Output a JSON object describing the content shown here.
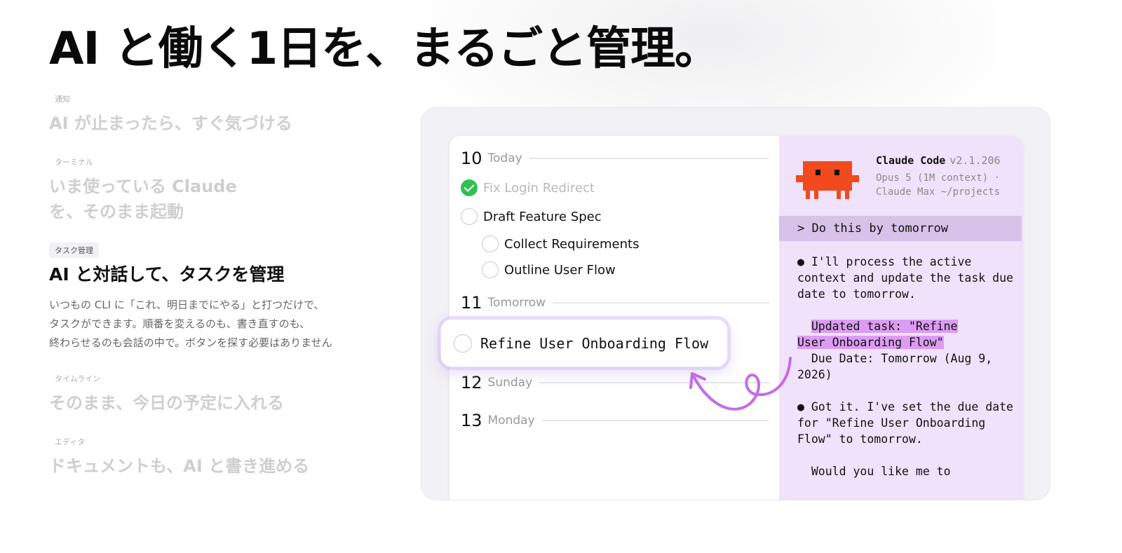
{
  "headline": "AI と働く1日を、まるごと管理。",
  "features": [
    {
      "tag": "通知",
      "title": "AI が止まったら、すぐ気づける"
    },
    {
      "tag": "ターミナル",
      "title": "いま使っている Claude\nを、そのまま起動"
    },
    {
      "tag": "タスク管理",
      "title": "AI と対話して、タスクを管理",
      "desc": "いつもの CLI に「これ、明日までにやる」と打つだけで、\nタスクができます。順番を変えるのも、書き直すのも、\n終わらせるのも会話の中で。ボタンを探す必要はありません"
    },
    {
      "tag": "タイムライン",
      "title": "そのまま、今日の予定に入れる"
    },
    {
      "tag": "エディタ",
      "title": "ドキュメントも、AI と書き進める"
    }
  ],
  "calendar": {
    "days": [
      {
        "num": "10",
        "label": "Today"
      },
      {
        "num": "11",
        "label": "Tomorrow"
      },
      {
        "num": "12",
        "label": "Sunday"
      },
      {
        "num": "13",
        "label": "Monday"
      }
    ],
    "tasks": [
      {
        "text": "Fix Login Redirect",
        "done": true
      },
      {
        "text": "Draft Feature Spec"
      },
      {
        "text": "Collect Requirements"
      },
      {
        "text": "Outline User Flow"
      }
    ],
    "dragged_task": "Refine User Onboarding Flow"
  },
  "terminal": {
    "name": "Claude Code",
    "version": "v2.1.206",
    "sub_line1": "Opus 5 (1M context) ·",
    "sub_line2": "Claude Max ~/projects",
    "prompt": "> Do this by tomorrow",
    "msg1": "● I'll process the active context and update the task due date to tomorrow.",
    "updated_line1": "Updated task: \"Refine",
    "updated_line2": "User Onboarding Flow\"",
    "due_line": "  Due Date: Tomorrow (Aug 9, 2026)",
    "msg2": "● Got it. I've set the due date for \"Refine User Onboarding Flow\" to tomorrow.",
    "msg3": "  Would you like me to"
  },
  "colors": {
    "accent_purple": "#c46be6",
    "terminal_bg": "#f0e2fa",
    "highlight": "#dc9cf3",
    "mascot": "#f04a1e",
    "check_green": "#30c04f"
  }
}
